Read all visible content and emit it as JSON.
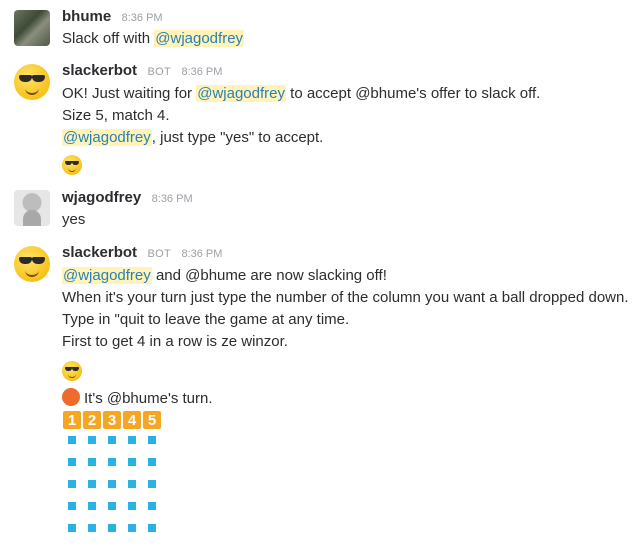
{
  "messages": [
    {
      "user": "bhume",
      "time": "8:36 PM",
      "lines": [
        {
          "pre": "Slack off with ",
          "mention": "@wjagodfrey",
          "post": ""
        }
      ]
    },
    {
      "user": "slackerbot",
      "bot_label": "BOT",
      "time": "8:36 PM",
      "lines": [
        {
          "pre": "OK! Just waiting for ",
          "mention": "@wjagodfrey",
          "post": " to accept @bhume's offer to slack off."
        },
        {
          "text": "Size 5, match 4."
        },
        {
          "pre": "",
          "mention": "@wjagodfrey",
          "post": ", just type \"yes\" to accept."
        }
      ],
      "emoji": "sunglasses-emoji"
    },
    {
      "user": "wjagodfrey",
      "time": "8:36 PM",
      "lines": [
        {
          "text": "yes"
        }
      ]
    },
    {
      "user": "slackerbot",
      "bot_label": "BOT",
      "time": "8:36 PM",
      "lines": [
        {
          "pre": "",
          "mention": "@wjagodfrey",
          "post": " and @bhume are now slacking off!"
        },
        {
          "text": "When it's your turn just type the number of the column you want a ball dropped down."
        },
        {
          "text": "Type in \"quit to leave the game at any time."
        },
        {
          "text": "First to get 4 in a row is ze winzor."
        }
      ],
      "emoji": "sunglasses-emoji",
      "turn_text": "It's @bhume's turn.",
      "columns": [
        "1",
        "2",
        "3",
        "4",
        "5"
      ],
      "grid": {
        "rows": 5,
        "cols": 5,
        "cell_color": "#29b2e4"
      }
    }
  ],
  "colors": {
    "mention_bg": "#fff3b8",
    "mention_text": "#2a80b9",
    "number_key": "#f6a623",
    "turn_ball": "#ee6b2c"
  }
}
